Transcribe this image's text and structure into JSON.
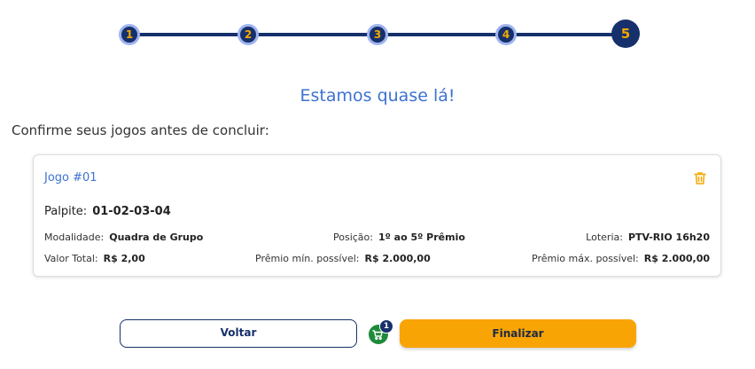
{
  "stepper": {
    "steps": [
      "1",
      "2",
      "3",
      "4",
      "5"
    ],
    "current": 5
  },
  "heading": "Estamos quase lá!",
  "subheading": "Confirme seus jogos antes de concluir:",
  "game": {
    "title": "Jogo #01",
    "palpite_label": "Palpite:",
    "palpite_value": "01-02-03-04",
    "modalidade_label": "Modalidade:",
    "modalidade_value": "Quadra de Grupo",
    "posicao_label": "Posição:",
    "posicao_value": "1º ao 5º Prêmio",
    "loteria_label": "Loteria:",
    "loteria_value": "PTV-RIO 16h20",
    "valor_total_label": "Valor Total:",
    "valor_total_value": "R$ 2,00",
    "premio_min_label": "Prêmio mín. possível:",
    "premio_min_value": "R$ 2.000,00",
    "premio_max_label": "Prêmio máx. possível:",
    "premio_max_value": "R$ 2.000,00"
  },
  "actions": {
    "back_label": "Voltar",
    "finish_label": "Finalizar",
    "cart_count": "1"
  },
  "colors": {
    "navy": "#16306b",
    "accent_blue": "#3d72d2",
    "orange": "#f9a405",
    "cart_green": "#1e8a3a"
  }
}
